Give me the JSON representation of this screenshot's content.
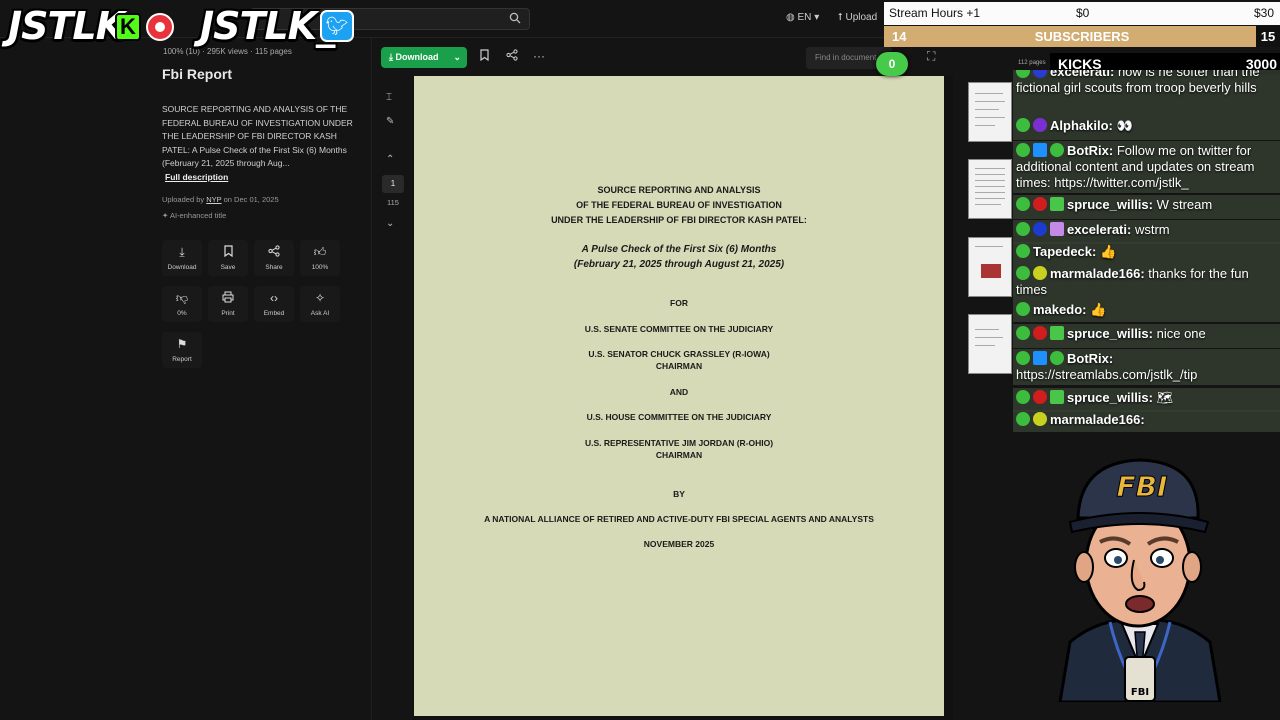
{
  "site": {
    "lang": "EN",
    "upload": "Upload"
  },
  "logos": {
    "kick_logo": "JSTLK",
    "kick_letter": "K",
    "twitter_logo": "JSTLK_"
  },
  "doc": {
    "stats": "100% (10) · 295K views · 115 pages",
    "title": "Fbi Report",
    "description": "SOURCE REPORTING AND ANALYSIS OF THE FEDERAL BUREAU OF INVESTIGATION UNDER THE LEADERSHIP OF FBI DIRECTOR KASH PATEL: A Pulse Check of the First Six (6) Months (February 21, 2025 through Aug...",
    "full_description": "Full description",
    "uploaded_prefix": "Uploaded by",
    "uploader": "NYP",
    "uploaded_date": "on Dec 01, 2025",
    "ai_title": "AI-enhanced title"
  },
  "actions": [
    {
      "label": "Download",
      "icon": "download-icon"
    },
    {
      "label": "Save",
      "icon": "bookmark-icon"
    },
    {
      "label": "Share",
      "icon": "share-icon"
    },
    {
      "label": "100%",
      "icon": "thumbs-up-icon"
    },
    {
      "label": "0%",
      "icon": "thumbs-down-icon"
    },
    {
      "label": "Print",
      "icon": "print-icon"
    },
    {
      "label": "Embed",
      "icon": "embed-icon"
    },
    {
      "label": "Ask AI",
      "icon": "sparkle-icon"
    },
    {
      "label": "Report",
      "icon": "flag-icon"
    }
  ],
  "toolbar": {
    "download_label": "Download",
    "find_placeholder": "Find in document",
    "page_current": "1",
    "page_total": "115"
  },
  "paper": {
    "heading1": "SOURCE REPORTING AND ANALYSIS",
    "heading2": "OF THE FEDERAL BUREAU OF INVESTIGATION",
    "heading3": "UNDER THE LEADERSHIP OF FBI DIRECTOR KASH PATEL:",
    "sub1": "A Pulse Check of the First Six (6) Months",
    "sub2": "(February 21, 2025 through August 21, 2025)",
    "for": "FOR",
    "senate": "U.S. SENATE COMMITTEE ON THE JUDICIARY",
    "senator": "U.S. SENATOR CHUCK GRASSLEY (R-IOWA)",
    "chair1": "CHAIRMAN",
    "and": "AND",
    "house": "U.S. HOUSE COMMITTEE ON THE JUDICIARY",
    "rep": "U.S. REPRESENTATIVE JIM JORDAN (R-OHIO)",
    "chair2": "CHAIRMAN",
    "by": "BY",
    "alliance": "A NATIONAL ALLIANCE OF RETIRED AND ACTIVE-DUTY FBI SPECIAL AGENTS AND ANALYSTS",
    "date": "NOVEMBER 2025"
  },
  "thumbs": {
    "page_count_label": "112 pages"
  },
  "overlay": {
    "goal_label": "Stream Hours +1",
    "goal_current": "$0",
    "goal_target": "$30",
    "subs_left": "14",
    "subs_label": "SUBSCRIBERS",
    "subs_right": "15",
    "kicks_label": "KICKS",
    "kicks_value": "3000",
    "zero_badge": "0"
  },
  "chat": [
    {
      "user": "excelerati:",
      "text": "how is he softer than the fictional girl scouts from troop beverly hills"
    },
    {
      "user": "Alphakilo:",
      "text": "👀"
    },
    {
      "user": "BotRix:",
      "text": "Follow me on twitter for additional content and updates on stream times: https://twitter.com/jstlk_"
    },
    {
      "user": "spruce_willis:",
      "text": "W stream"
    },
    {
      "user": "excelerati:",
      "text": "wstrm"
    },
    {
      "user": "Tapedeck:",
      "text": "👍"
    },
    {
      "user": "marmalade166:",
      "text": "thanks for the fun times"
    },
    {
      "user": "makedo:",
      "text": "👍"
    },
    {
      "user": "spruce_willis:",
      "text": "nice one"
    },
    {
      "user": "BotRix:",
      "text": "https://streamlabs.com/jstlk_/tip"
    },
    {
      "user": "spruce_willis:",
      "text": "🗺"
    },
    {
      "user": "marmalade166:",
      "text": ""
    }
  ],
  "mascot": {
    "cap_text": "FBI",
    "badge_text": "FBI"
  },
  "colors": {
    "download_green": "#1aa04a",
    "paper": "#d7dab7",
    "subs_gold": "#d3ac72",
    "kick_green": "#53fc18"
  }
}
